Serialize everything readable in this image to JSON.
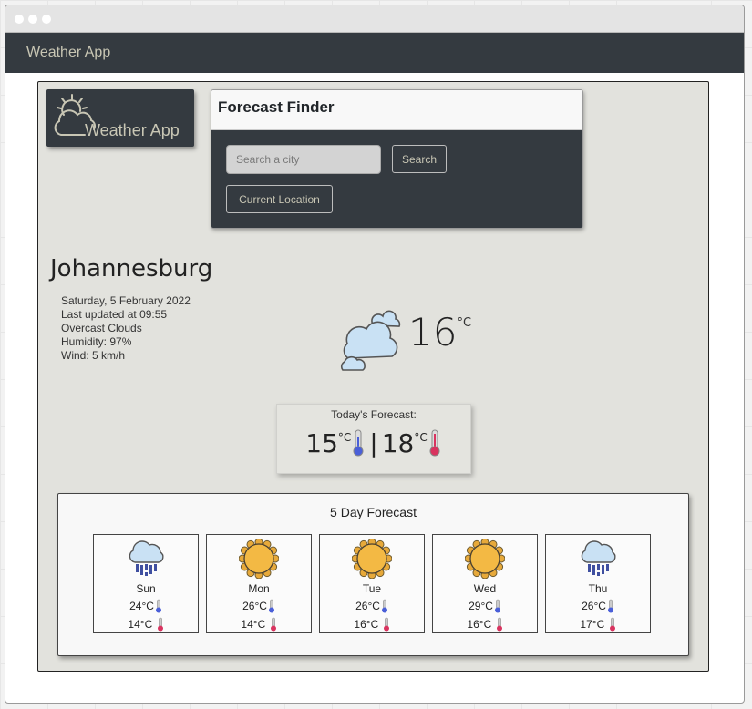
{
  "window": {
    "controls": [
      "dot",
      "dot",
      "dot"
    ]
  },
  "navbar": {
    "brand": "Weather App"
  },
  "logo": {
    "text": "Weather App",
    "icon": "sun-cloud-icon"
  },
  "finder": {
    "title": "Forecast Finder",
    "search_placeholder": "Search a city",
    "search_value": "",
    "search_button": "Search",
    "location_button": "Current Location"
  },
  "current": {
    "city": "Johannesburg",
    "date": "Saturday, 5 February 2022",
    "updated": "Last updated at 09:55",
    "description": "Overcast Clouds",
    "humidity": "Humidity: 97%",
    "wind": "Wind: 5 km/h",
    "temp": "16",
    "unit": "°C",
    "icon": "overcast-clouds-icon"
  },
  "today": {
    "label": "Today's Forecast:",
    "min": "15",
    "max": "18",
    "unit": "°C",
    "separator": "|"
  },
  "forecast": {
    "title": "5 Day Forecast",
    "days": [
      {
        "name": "Sun",
        "high": "24°C",
        "low": "14°C",
        "icon": "rain"
      },
      {
        "name": "Mon",
        "high": "26°C",
        "low": "14°C",
        "icon": "sun"
      },
      {
        "name": "Tue",
        "high": "26°C",
        "low": "16°C",
        "icon": "sun"
      },
      {
        "name": "Wed",
        "high": "29°C",
        "low": "16°C",
        "icon": "sun"
      },
      {
        "name": "Thu",
        "high": "26°C",
        "low": "17°C",
        "icon": "rain"
      }
    ]
  },
  "colors": {
    "navbar": "#343a40",
    "brand_text": "#c8c6b4",
    "panel": "#e2e2dd",
    "thermo_cold": "#4a5fd8",
    "thermo_hot": "#d9335f",
    "sun": "#f3b944",
    "cloud": "#c9e1f4",
    "rain": "#3f4fa0"
  }
}
